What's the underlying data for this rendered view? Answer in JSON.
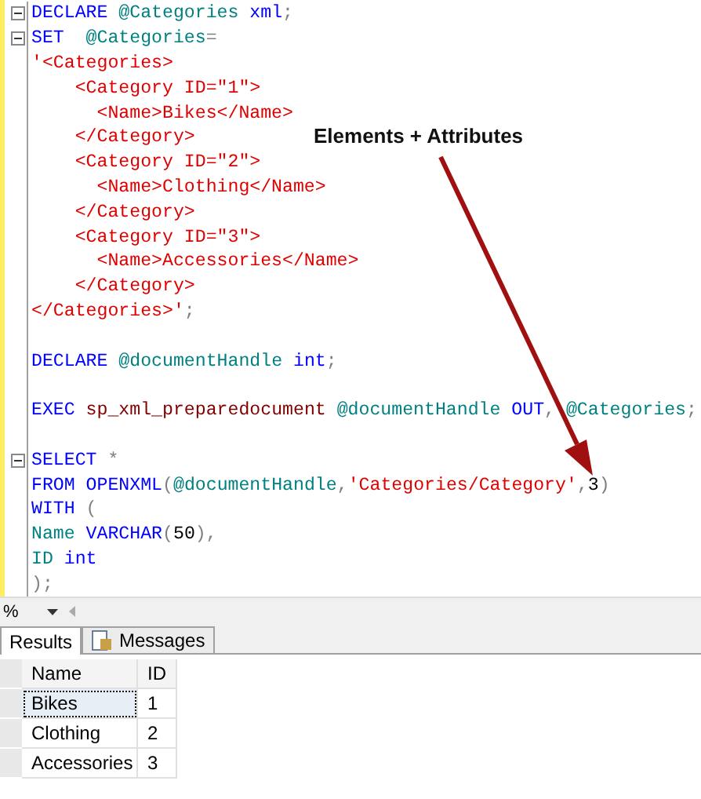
{
  "editor": {
    "lines": [
      {
        "fold": true,
        "tokens": [
          {
            "kind": "keyword",
            "text": "DECLARE"
          },
          {
            "kind": "variable",
            "text": " @Categories"
          },
          {
            "kind": "keyword",
            "text": " xml"
          },
          {
            "kind": "punct",
            "text": ";"
          }
        ]
      },
      {
        "fold": true,
        "tokens": [
          {
            "kind": "keyword",
            "text": "SET"
          },
          {
            "kind": "variable",
            "text": "  @Categories"
          },
          {
            "kind": "punct",
            "text": "="
          }
        ]
      },
      {
        "fold": false,
        "tokens": [
          {
            "kind": "string",
            "text": "'<Categories>"
          }
        ]
      },
      {
        "fold": false,
        "tokens": [
          {
            "kind": "string",
            "text": "    <Category ID=\"1\">"
          }
        ]
      },
      {
        "fold": false,
        "tokens": [
          {
            "kind": "string",
            "text": "      <Name>Bikes</Name>"
          }
        ]
      },
      {
        "fold": false,
        "tokens": [
          {
            "kind": "string",
            "text": "    </Category>"
          }
        ]
      },
      {
        "fold": false,
        "tokens": [
          {
            "kind": "string",
            "text": "    <Category ID=\"2\">"
          }
        ]
      },
      {
        "fold": false,
        "tokens": [
          {
            "kind": "string",
            "text": "      <Name>Clothing</Name>"
          }
        ]
      },
      {
        "fold": false,
        "tokens": [
          {
            "kind": "string",
            "text": "    </Category>"
          }
        ]
      },
      {
        "fold": false,
        "tokens": [
          {
            "kind": "string",
            "text": "    <Category ID=\"3\">"
          }
        ]
      },
      {
        "fold": false,
        "tokens": [
          {
            "kind": "string",
            "text": "      <Name>Accessories</Name>"
          }
        ]
      },
      {
        "fold": false,
        "tokens": [
          {
            "kind": "string",
            "text": "    </Category>"
          }
        ]
      },
      {
        "fold": false,
        "tokens": [
          {
            "kind": "string",
            "text": "</Categories>'"
          },
          {
            "kind": "punct",
            "text": ";"
          }
        ]
      },
      {
        "fold": false
      },
      {
        "fold": false,
        "tokens": [
          {
            "kind": "keyword",
            "text": "DECLARE"
          },
          {
            "kind": "variable",
            "text": " @documentHandle"
          },
          {
            "kind": "keyword",
            "text": " int"
          },
          {
            "kind": "punct",
            "text": ";"
          }
        ]
      },
      {
        "fold": false
      },
      {
        "fold": false,
        "tokens": [
          {
            "kind": "keyword",
            "text": "EXEC"
          },
          {
            "kind": "proc",
            "text": " sp_xml_preparedocument"
          },
          {
            "kind": "variable",
            "text": " @documentHandle"
          },
          {
            "kind": "keyword",
            "text": " OUT"
          },
          {
            "kind": "punct",
            "text": ","
          },
          {
            "kind": "variable",
            "text": " @Categories"
          },
          {
            "kind": "punct",
            "text": ";"
          }
        ]
      },
      {
        "fold": false
      },
      {
        "fold": true,
        "tokens": [
          {
            "kind": "keyword",
            "text": "SELECT"
          },
          {
            "kind": "punct",
            "text": " *"
          }
        ]
      },
      {
        "fold": false,
        "tokens": [
          {
            "kind": "keyword",
            "text": "FROM"
          },
          {
            "kind": "keyword",
            "text": " OPENXML"
          },
          {
            "kind": "punct",
            "text": "("
          },
          {
            "kind": "variable",
            "text": "@documentHandle"
          },
          {
            "kind": "punct",
            "text": ","
          },
          {
            "kind": "string",
            "text": "'Categories/Category'"
          },
          {
            "kind": "punct",
            "text": ","
          },
          {
            "kind": "plain",
            "text": "3"
          },
          {
            "kind": "punct",
            "text": ")"
          }
        ]
      },
      {
        "fold": false,
        "tokens": [
          {
            "kind": "keyword",
            "text": "WITH"
          },
          {
            "kind": "punct",
            "text": " ("
          }
        ]
      },
      {
        "fold": false,
        "tokens": [
          {
            "kind": "variable",
            "text": "Name"
          },
          {
            "kind": "keyword",
            "text": " VARCHAR"
          },
          {
            "kind": "punct",
            "text": "("
          },
          {
            "kind": "plain",
            "text": "50"
          },
          {
            "kind": "punct",
            "text": "),"
          }
        ]
      },
      {
        "fold": false,
        "tokens": [
          {
            "kind": "variable",
            "text": "ID"
          },
          {
            "kind": "keyword",
            "text": " int"
          }
        ]
      },
      {
        "fold": false,
        "tokens": [
          {
            "kind": "punct",
            "text": ");"
          }
        ]
      }
    ]
  },
  "annotation": {
    "label": "Elements + Attributes"
  },
  "zoom": {
    "value": "%"
  },
  "tabs": [
    {
      "label": "Results",
      "selected": true
    },
    {
      "label": "Messages",
      "selected": false
    }
  ],
  "grid": {
    "columns": [
      "Name",
      "ID"
    ],
    "rows": [
      {
        "cells": [
          "Bikes",
          "1"
        ],
        "selected": true
      },
      {
        "cells": [
          "Clothing",
          "2"
        ],
        "selected": false
      },
      {
        "cells": [
          "Accessories",
          "3"
        ],
        "selected": false
      }
    ]
  }
}
